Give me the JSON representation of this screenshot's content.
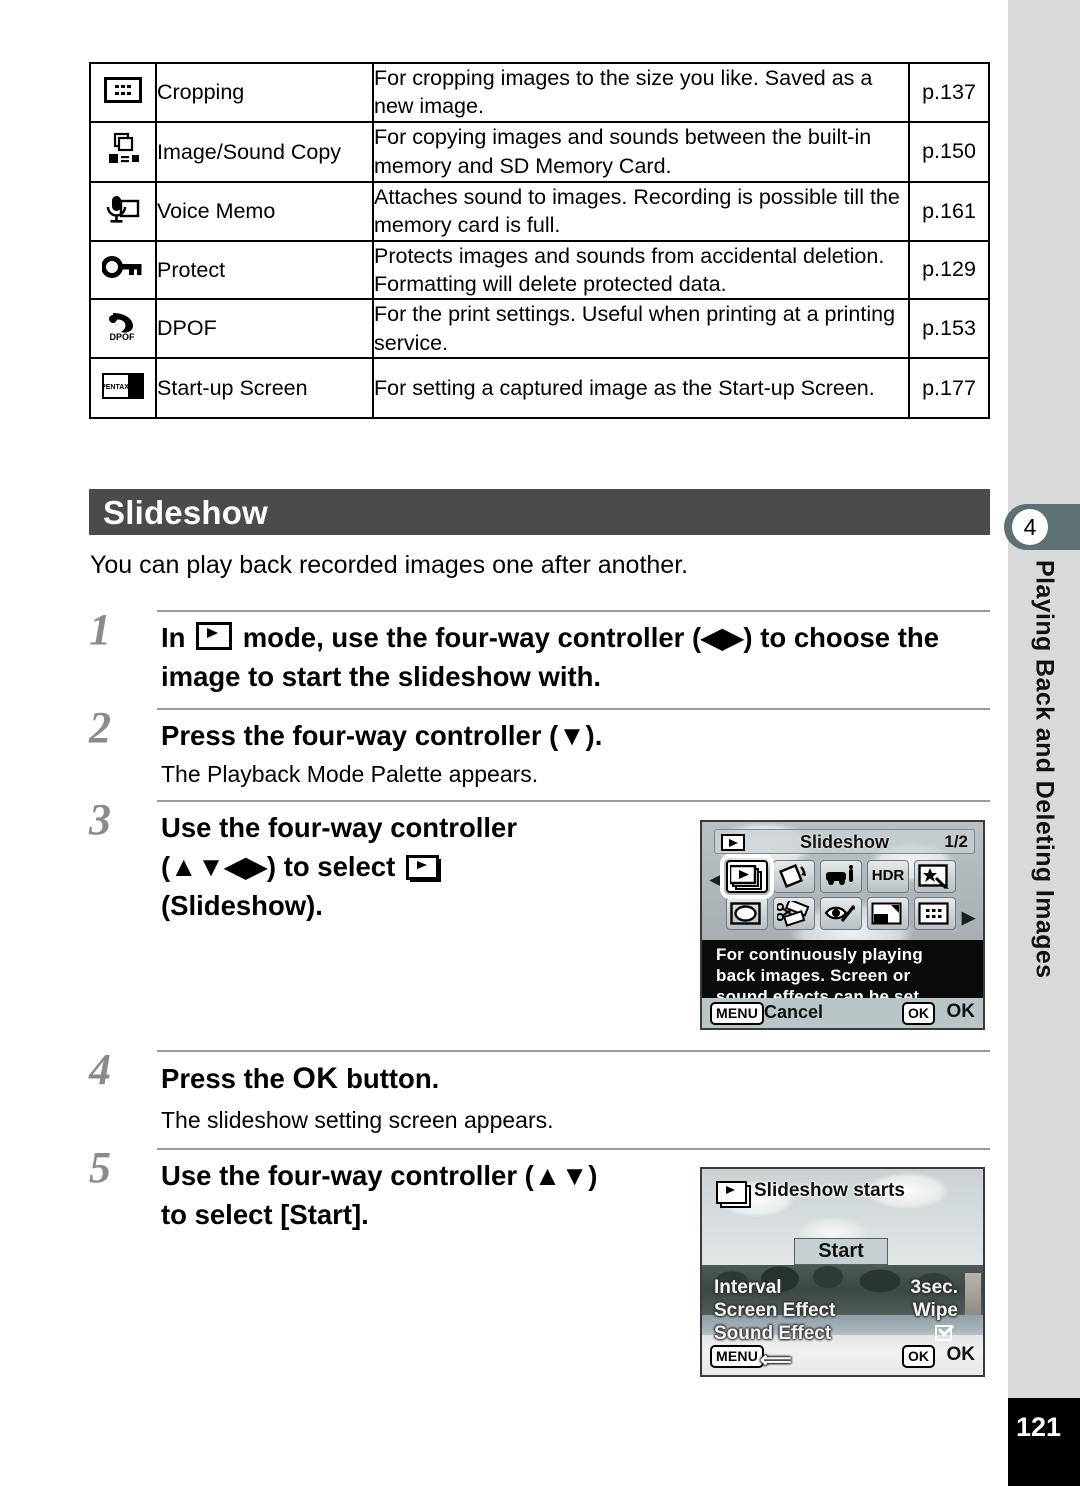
{
  "page": {
    "number": "121",
    "chapter_number": "4",
    "chapter_title": "Playing Back and Deleting Images"
  },
  "feature_table": {
    "rows": [
      {
        "icon": "cropping-icon",
        "name": "Cropping",
        "description": "For cropping images to the size you like. Saved as a new image.",
        "page_ref": "p.137"
      },
      {
        "icon": "image-sound-copy-icon",
        "name": "Image/Sound Copy",
        "description": "For copying images and sounds between the built-in memory and SD Memory Card.",
        "page_ref": "p.150"
      },
      {
        "icon": "voice-memo-icon",
        "name": "Voice Memo",
        "description": "Attaches sound to images. Recording is possible till the memory card is full.",
        "page_ref": "p.161"
      },
      {
        "icon": "protect-key-icon",
        "name": "Protect",
        "description": "Protects images and sounds from accidental deletion. Formatting will delete protected data.",
        "page_ref": "p.129"
      },
      {
        "icon": "dpof-icon",
        "name": "DPOF",
        "description": "For the print settings. Useful when printing at a printing service.",
        "page_ref": "p.153"
      },
      {
        "icon": "start-up-screen-icon",
        "name": "Start-up Screen",
        "description": "For setting a captured image as the Start-up Screen.",
        "page_ref": "p.177"
      }
    ]
  },
  "section": {
    "title": "Slideshow",
    "intro": "You can play back recorded images one after another."
  },
  "steps": [
    {
      "number": "1",
      "title_before": "In",
      "title_after": "mode, use the four-way controller (◀▶) to choose the image to start the slideshow with.",
      "note": ""
    },
    {
      "number": "2",
      "title": "Press the four-way controller (▼).",
      "note": "The Playback Mode Palette appears."
    },
    {
      "number": "3",
      "title_line1": "Use the four-way controller",
      "title_line2": "(▲▼◀▶) to select",
      "title_line3": "(Slideshow).",
      "note": ""
    },
    {
      "number": "4",
      "title_before": "Press the",
      "title_ok": "OK",
      "title_after": "button.",
      "note": "The slideshow setting screen appears."
    },
    {
      "number": "5",
      "title_line1": "Use the four-way controller (▲▼)",
      "title_line2": "to select [Start].",
      "note": ""
    }
  ],
  "lcd_palette": {
    "title": "Slideshow",
    "page_indicator": "1/2",
    "title_icon": "playback-mode-icon",
    "icons_row1": [
      "slideshow-icon",
      "image-rotation-icon",
      "small-face-filter-icon",
      "HDR",
      "digital-filter-icon"
    ],
    "icons_row2": [
      "frame-composite-icon",
      "movie-edit-icon",
      "red-eye-edit-icon",
      "original-frame-icon",
      "cropping-icon"
    ],
    "hdr_label": "HDR",
    "description_lines": [
      "For continuously playing",
      "back images. Screen or",
      "sound effects can be set"
    ],
    "menu_button": "MENU",
    "cancel_label": "Cancel",
    "ok_button": "OK",
    "ok_label": "OK",
    "arrow_left": "◀",
    "arrow_right": "▶"
  },
  "lcd_setting": {
    "title": "Slideshow starts",
    "title_icon": "slideshow-icon",
    "start_button": "Start",
    "settings": [
      {
        "label": "Interval",
        "value": "3sec."
      },
      {
        "label": "Screen Effect",
        "value": "Wipe"
      },
      {
        "label": "Sound Effect",
        "value": "checked"
      }
    ],
    "menu_button": "MENU",
    "back_icon": "back-arrow-icon",
    "ok_button": "OK",
    "ok_label": "OK"
  }
}
